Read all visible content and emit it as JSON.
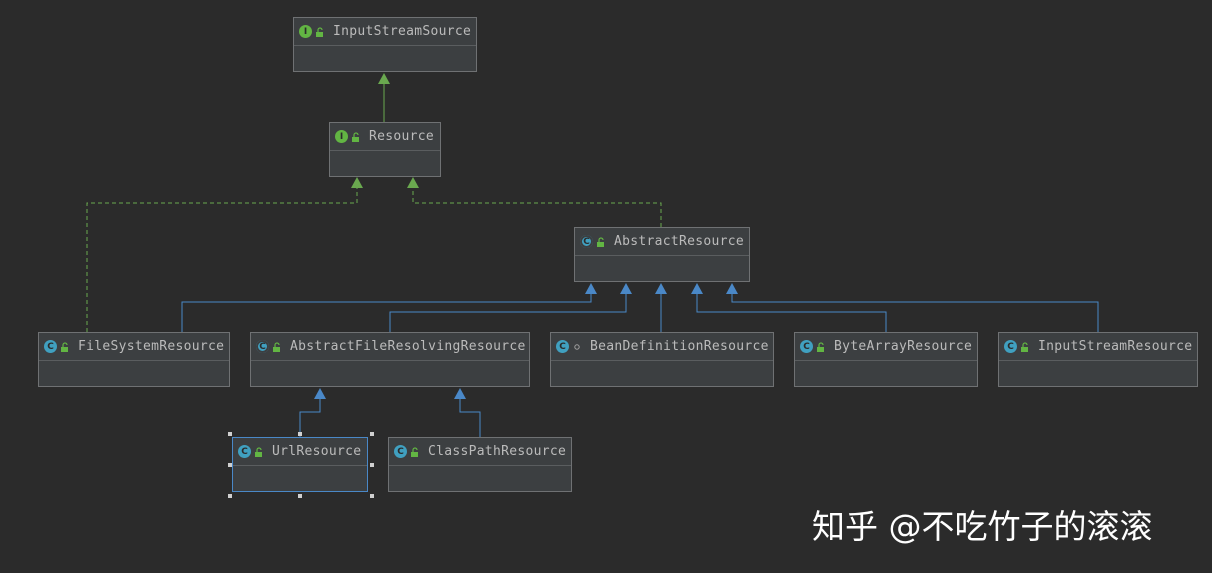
{
  "colors": {
    "background": "#2b2b2b",
    "node_fill": "#3c3f41",
    "interface_badge": "#62b543",
    "class_badge": "#40a0c0",
    "implements_edge": "#6aa84f",
    "extends_edge": "#4a88c7",
    "selection": "#4a88c7"
  },
  "nodes": [
    {
      "id": "inputstreamsource",
      "label": "InputStreamSource",
      "kind": "interface",
      "kind_letter": "I",
      "access_icon": "unlock-icon"
    },
    {
      "id": "resource",
      "label": "Resource",
      "kind": "interface",
      "kind_letter": "I",
      "access_icon": "unlock-icon"
    },
    {
      "id": "abstractresource",
      "label": "AbstractResource",
      "kind": "abstract-class",
      "kind_letter": "C",
      "access_icon": "unlock-icon"
    },
    {
      "id": "filesystemresource",
      "label": "FileSystemResource",
      "kind": "class",
      "kind_letter": "C",
      "access_icon": "unlock-icon"
    },
    {
      "id": "abstractfileresolvingresource",
      "label": "AbstractFileResolvingResource",
      "kind": "abstract-class",
      "kind_letter": "C",
      "access_icon": "unlock-icon"
    },
    {
      "id": "beandefinitionresource",
      "label": "BeanDefinitionResource",
      "kind": "class",
      "kind_letter": "C",
      "access_icon": "package-private-icon"
    },
    {
      "id": "bytearrayresource",
      "label": "ByteArrayResource",
      "kind": "class",
      "kind_letter": "C",
      "access_icon": "unlock-icon"
    },
    {
      "id": "inputstreamresource",
      "label": "InputStreamResource",
      "kind": "class",
      "kind_letter": "C",
      "access_icon": "unlock-icon"
    },
    {
      "id": "urlresource",
      "label": "UrlResource",
      "kind": "class",
      "kind_letter": "C",
      "access_icon": "unlock-icon",
      "selected": true
    },
    {
      "id": "classpathresource",
      "label": "ClassPathResource",
      "kind": "class",
      "kind_letter": "C",
      "access_icon": "unlock-icon"
    }
  ],
  "edges": [
    {
      "from": "resource",
      "to": "inputstreamsource",
      "type": "interface-extends"
    },
    {
      "from": "filesystemresource",
      "to": "resource",
      "type": "implements"
    },
    {
      "from": "abstractresource",
      "to": "resource",
      "type": "implements"
    },
    {
      "from": "filesystemresource",
      "to": "abstractresource",
      "type": "extends"
    },
    {
      "from": "abstractfileresolvingresource",
      "to": "abstractresource",
      "type": "extends"
    },
    {
      "from": "beandefinitionresource",
      "to": "abstractresource",
      "type": "extends"
    },
    {
      "from": "bytearrayresource",
      "to": "abstractresource",
      "type": "extends"
    },
    {
      "from": "inputstreamresource",
      "to": "abstractresource",
      "type": "extends"
    },
    {
      "from": "urlresource",
      "to": "abstractfileresolvingresource",
      "type": "extends"
    },
    {
      "from": "classpathresource",
      "to": "abstractfileresolvingresource",
      "type": "extends"
    }
  ],
  "watermark": "知乎 @不吃竹子的滚滚"
}
